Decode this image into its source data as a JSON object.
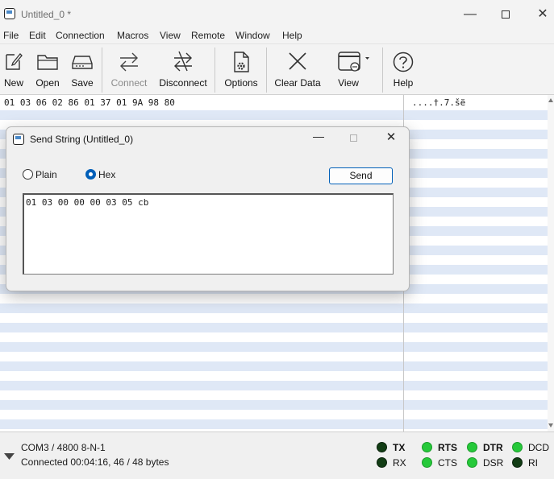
{
  "window": {
    "title": "Untitled_0 *"
  },
  "menu": [
    "File",
    "Edit",
    "Connection",
    "Macros",
    "View",
    "Remote",
    "Window",
    "Help"
  ],
  "toolbar": {
    "new": "New",
    "open": "Open",
    "save": "Save",
    "connect": "Connect",
    "disconnect": "Disconnect",
    "options": "Options",
    "clear": "Clear Data",
    "view": "View",
    "help": "Help"
  },
  "terminal": {
    "hex_line": "01 03 06 02 86 01 37 01 9A 98 80",
    "ascii_line": "....†.7.šë"
  },
  "dialog": {
    "title": "Send String (Untitled_0)",
    "plain_label": "Plain",
    "hex_label": "Hex",
    "mode": "hex",
    "send_label": "Send",
    "input_value": "01 03 00 00 00 03 05 cb"
  },
  "status": {
    "port": "COM3 / 4800 8-N-1",
    "connection": "Connected 00:04:16, 46 / 48 bytes",
    "leds": {
      "tx": {
        "label": "TX",
        "on": false
      },
      "rx": {
        "label": "RX",
        "on": false
      },
      "rts": {
        "label": "RTS",
        "on": true
      },
      "cts": {
        "label": "CTS",
        "on": true
      },
      "dtr": {
        "label": "DTR",
        "on": true
      },
      "dsr": {
        "label": "DSR",
        "on": true
      },
      "dcd": {
        "label": "DCD",
        "on": true
      },
      "ri": {
        "label": "RI",
        "on": false
      }
    }
  },
  "colors": {
    "accent": "#005fb8",
    "stripe": "#dfe8f6",
    "led_on": "#26c93a",
    "led_off": "#123d15"
  }
}
